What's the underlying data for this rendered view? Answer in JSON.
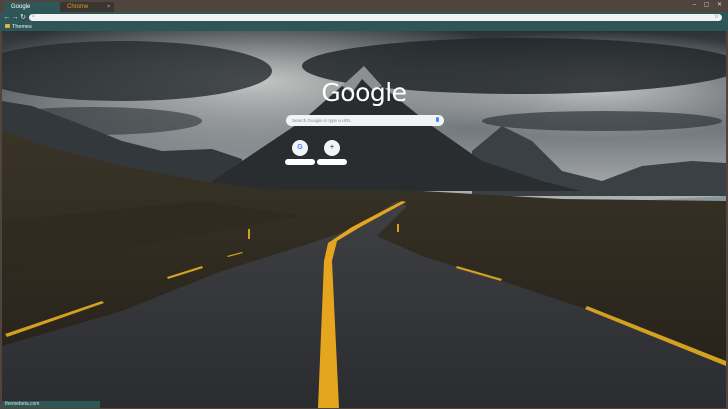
{
  "tabs": [
    {
      "label": "Google",
      "active": true
    },
    {
      "label": "Chrome",
      "active": false
    }
  ],
  "window_controls": "– ▢ ✕",
  "toolbar": {
    "back_icon": "arrow-left-icon",
    "forward_icon": "arrow-right-icon",
    "reload_icon": "reload-icon",
    "star_icon": "star-icon",
    "omnibox_value": ""
  },
  "bookmarks": [
    {
      "label": "Themes"
    }
  ],
  "ntp": {
    "logo_text": "Google",
    "search_placeholder": "Search Google or type a URL",
    "shortcuts": [
      {
        "icon": "G",
        "label": ""
      },
      {
        "icon": "+",
        "label": ""
      }
    ]
  },
  "status": {
    "text": "themebeta.com"
  },
  "colors": {
    "frame": "#50443f",
    "toolbar": "#2f5656",
    "active_tab_text": "#ffffff",
    "inactive_tab_text": "#e29a2c",
    "road_line": "#e5a51e"
  }
}
